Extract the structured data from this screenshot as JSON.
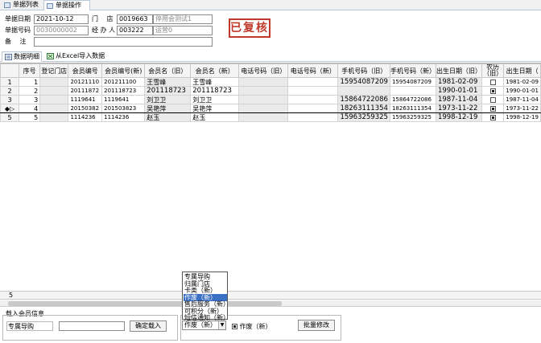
{
  "top_tabs": [
    {
      "label": "单据列表",
      "active": false
    },
    {
      "label": "单据操作",
      "active": true
    }
  ],
  "header": {
    "date_label": "单据日期",
    "date_value": "2021-10-12",
    "store_label": "门　 店",
    "store_code": "0019663",
    "store_name": "停用会测试1",
    "bill_no_label": "单据号码",
    "bill_no_value": "0030000002",
    "handler_label": "经 办 人",
    "handler_code": "003222",
    "handler_name": "运营0",
    "remark_label": "备　 注",
    "remark_value": "",
    "stamp": "已复核"
  },
  "sub_tabs": [
    {
      "label": "数据明细",
      "active": true
    },
    {
      "label": "从Excel导入数据",
      "active": false
    }
  ],
  "grid": {
    "columns": [
      "序号",
      "登记门店",
      "会员编号",
      "会员编号(新)",
      "会员名（旧）",
      "会员名（新）",
      "电话号码（旧）",
      "电话号码（新）",
      "手机号码（旧）",
      "手机号码（新）",
      "出生日期（旧）",
      "农历（旧）",
      "出生日期（"
    ],
    "rows": [
      {
        "indicator": "1",
        "seq": "1",
        "store": "",
        "member_no": "20121110",
        "member_no_new": "201211100",
        "name_old": "王雪峰",
        "name_new": "王雪峰",
        "phone_old": "",
        "phone_new": "",
        "mobile_old": "15954087209",
        "mobile_new": "15954087209",
        "birth_old": "1981-02-09",
        "lunar_old": false,
        "birth_new": "1981-02-09"
      },
      {
        "indicator": "2",
        "seq": "2",
        "store": "",
        "member_no": "20111872",
        "member_no_new": "201118723",
        "name_old": "201118723",
        "name_new": "201118723",
        "phone_old": "",
        "phone_new": "",
        "mobile_old": "",
        "mobile_new": "",
        "birth_old": "1990-01-01",
        "lunar_old": true,
        "birth_new": "1990-01-01"
      },
      {
        "indicator": "3",
        "seq": "3",
        "store": "",
        "member_no": "1119641",
        "member_no_new": "1119641",
        "name_old": "刘卫卫",
        "name_new": "刘卫卫",
        "phone_old": "",
        "phone_new": "",
        "mobile_old": "15864722086",
        "mobile_new": "15864722086",
        "birth_old": "1987-11-04",
        "lunar_old": false,
        "birth_new": "1987-11-04"
      },
      {
        "indicator": "4",
        "seq": "4",
        "store": "",
        "member_no": "20150382",
        "member_no_new": "201503823",
        "name_old": "吴艳萍",
        "name_new": "吴艳萍",
        "phone_old": "",
        "phone_new": "",
        "mobile_old": "18263111354",
        "mobile_new": "18263111354",
        "birth_old": "1973-11-22",
        "lunar_old": true,
        "birth_new": "1973-11-22",
        "current": true
      },
      {
        "indicator": "5",
        "seq": "5",
        "store": "",
        "member_no": "1114236",
        "member_no_new": "1114236",
        "name_old": "赵玉",
        "name_new": "赵玉",
        "phone_old": "",
        "phone_new": "",
        "mobile_old": "15963259325",
        "mobile_new": "15963259325",
        "birth_old": "1998-12-19",
        "lunar_old": true,
        "birth_new": "1998-12-19"
      }
    ],
    "footer_count": "5"
  },
  "load_panel": {
    "title": "载入会员信息",
    "field_label": "专属导购",
    "input_value": "",
    "confirm_label": "确定载入"
  },
  "batch_panel": {
    "dropdown_items": [
      "专属导购",
      "归属门店",
      "卡类（新）",
      "作废（新）",
      "售后服务（新）",
      "可积分（新）",
      "短信通知（新）"
    ],
    "selected_index": 3,
    "selected_value": "作废（新）",
    "checkbox_label": "作废（新）",
    "checkbox_checked": true,
    "batch_label": "批量修改"
  }
}
